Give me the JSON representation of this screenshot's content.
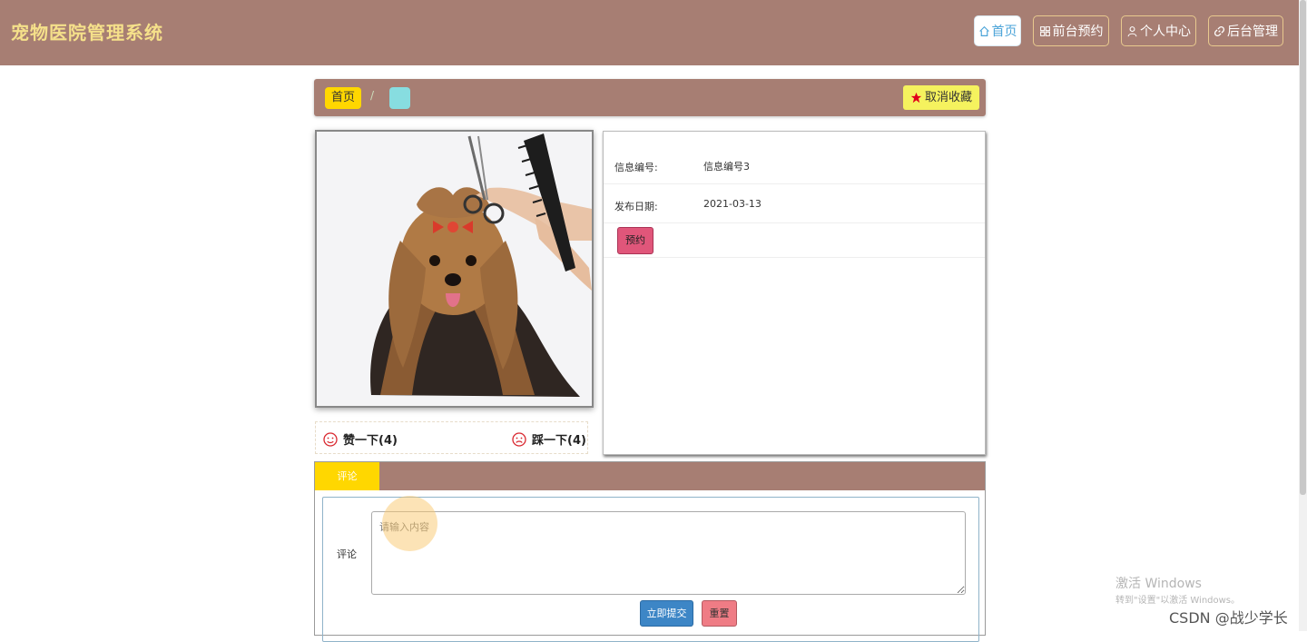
{
  "header": {
    "brand": "宠物医院管理系统",
    "nav": [
      {
        "label": "首页",
        "icon": "home-icon",
        "active": true
      },
      {
        "label": "前台预约",
        "icon": "grid-icon",
        "active": false
      },
      {
        "label": "个人中心",
        "icon": "user-icon",
        "active": false
      },
      {
        "label": "后台管理",
        "icon": "link-icon",
        "active": false
      }
    ]
  },
  "breadcrumb": {
    "home": "首页",
    "separator": "/",
    "favorite_label": "取消收藏"
  },
  "detail": {
    "rows": [
      {
        "label": "信息编号:",
        "value": "信息编号3"
      },
      {
        "label": "发布日期:",
        "value": "2021-03-13"
      }
    ],
    "book_button": "预约",
    "like_label": "赞一下(4)",
    "dislike_label": "踩一下(4)"
  },
  "comments": {
    "tab": "评论",
    "field_label": "评论",
    "placeholder": "请输入内容",
    "submit": "立即提交",
    "reset": "重置"
  },
  "overlay": {
    "activate_title": "激活 Windows",
    "activate_sub": "转到\"设置\"以激活 Windows。",
    "credit": "CSDN @战少学长"
  },
  "colors": {
    "header_bg": "#a77e73",
    "brand_text": "#f5e08a",
    "tab_active": "#ffd700",
    "favorite_btn": "#f5f25e",
    "book_btn": "#e0567a",
    "submit_btn": "#3d86c6",
    "reset_btn": "#ef7c85"
  }
}
